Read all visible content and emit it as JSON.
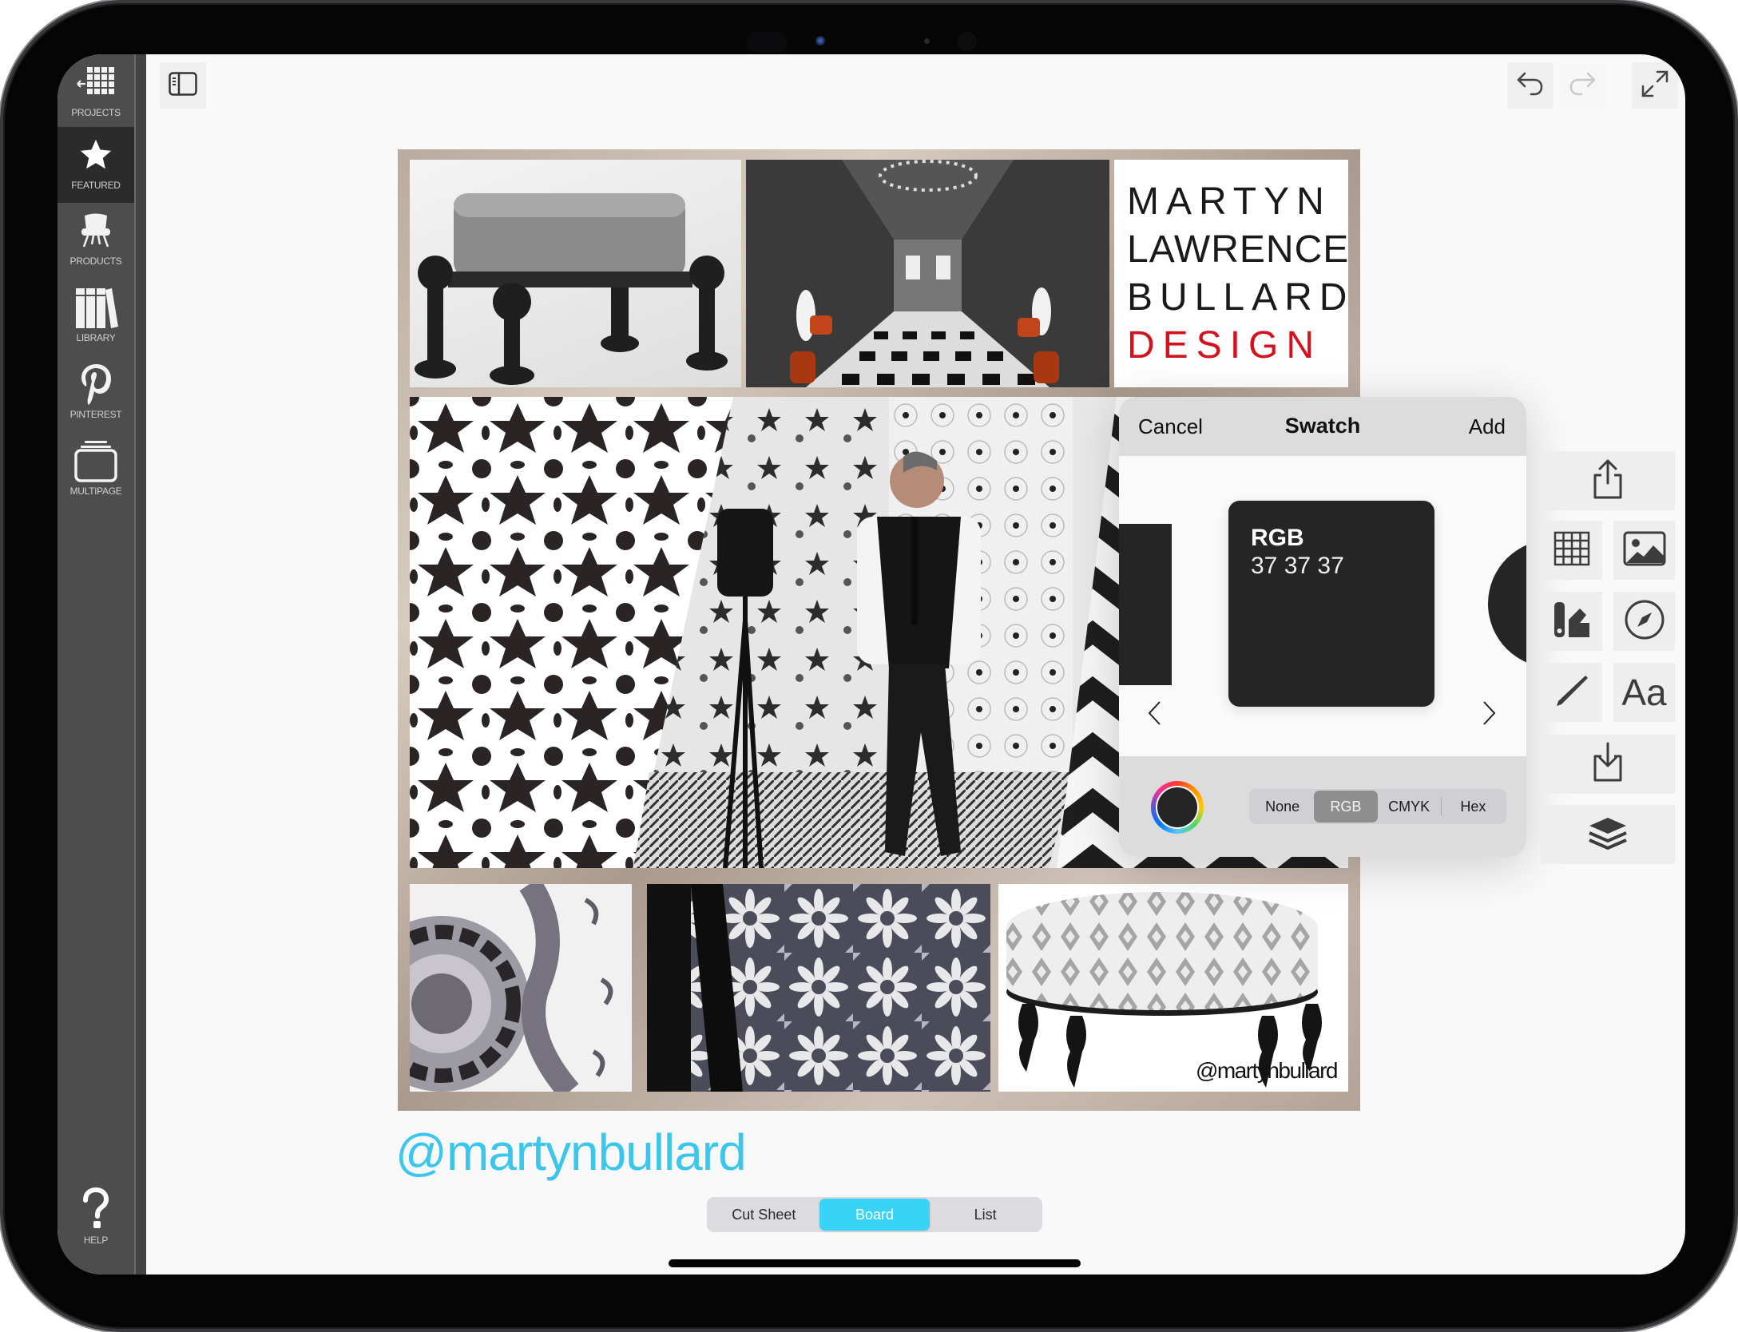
{
  "device": {
    "type": "iPad"
  },
  "sidebar": {
    "items": [
      {
        "label": "PROJECTS",
        "icon": "projects-grid-icon",
        "active": false
      },
      {
        "label": "FEATURED",
        "icon": "star-icon",
        "active": true
      },
      {
        "label": "PRODUCTS",
        "icon": "chair-icon",
        "active": false
      },
      {
        "label": "LIBRARY",
        "icon": "books-icon",
        "active": false
      },
      {
        "label": "PINTEREST",
        "icon": "pinterest-icon",
        "active": false
      },
      {
        "label": "MULTIPAGE",
        "icon": "multipage-icon",
        "active": false
      }
    ],
    "help": {
      "label": "HELP",
      "icon": "help-icon"
    }
  },
  "toolbar": {
    "sidebar_toggle": "sidebar-toggle-icon",
    "undo": "undo-icon",
    "redo": "redo-icon",
    "redo_enabled": false,
    "fullscreen": "expand-icon"
  },
  "board": {
    "logo_lines": [
      "MARTYN",
      "LAWRENCE",
      "BULLARD",
      "DESIGN"
    ],
    "watermark": "@martynbullard",
    "tiles": [
      "upholstered-stool-image",
      "hallway-interior-image",
      "logo-tile",
      "moroccan-pattern-image",
      "designer-portrait-image",
      "chevron-pattern-image",
      "suzani-fabric-image",
      "tile-floor-image",
      "round-ottoman-image"
    ]
  },
  "caption": "@martynbullard",
  "view_modes": {
    "options": [
      "Cut Sheet",
      "Board",
      "List"
    ],
    "selected": "Board"
  },
  "swatch_popover": {
    "cancel_label": "Cancel",
    "title": "Swatch",
    "add_label": "Add",
    "current": {
      "model": "RGB",
      "values": "37 37 37",
      "color": "#252525"
    },
    "formats": [
      "None",
      "RGB",
      "CMYK",
      "Hex"
    ],
    "selected_format": "RGB"
  },
  "right_toolbar": {
    "buttons": [
      "share-icon",
      "grid-icon",
      "image-icon",
      "swatch-fan-icon",
      "compass-icon",
      "pencil-icon",
      "text-icon",
      "import-icon",
      "layers-icon"
    ],
    "text_label": "Aa"
  },
  "colors": {
    "accent": "#38d3f5",
    "caption": "#3cc6ee",
    "logo_red": "#d2131e",
    "sidebar": "#4d4d4d"
  }
}
